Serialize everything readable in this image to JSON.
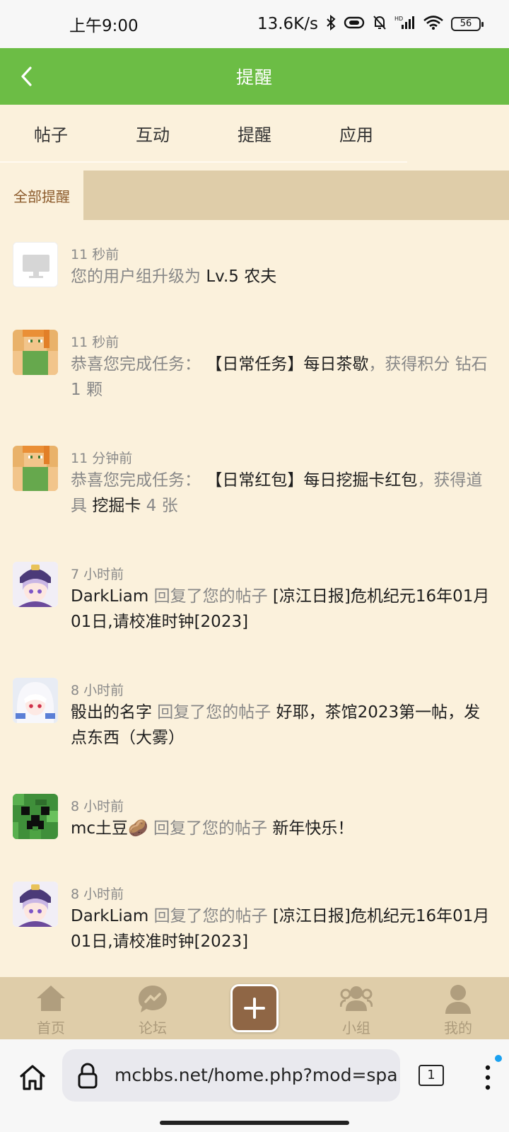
{
  "status_bar": {
    "time": "上午9:00",
    "speed": "13.6K/s",
    "battery": "56"
  },
  "header": {
    "title": "提醒"
  },
  "tabs": [
    {
      "label": "帖子"
    },
    {
      "label": "互动"
    },
    {
      "label": "提醒"
    },
    {
      "label": "应用"
    }
  ],
  "filter": {
    "label": "全部提醒"
  },
  "notifications": [
    {
      "time": "11 秒前",
      "avatar": "monitor-icon",
      "parts": [
        {
          "text": "您的用户组升级为 ",
          "dark": false
        },
        {
          "text": "Lv.5 农夫",
          "dark": true
        }
      ]
    },
    {
      "time": "11 秒前",
      "avatar": "alex-avatar",
      "parts": [
        {
          "text": "恭喜您完成任务： ",
          "dark": false
        },
        {
          "text": "【日常任务】每日茶歇",
          "dark": true
        },
        {
          "text": "，获得积分 ",
          "dark": false
        },
        {
          "text": "钻石 1 颗",
          "dark": false
        }
      ]
    },
    {
      "time": "11 分钟前",
      "avatar": "alex-avatar",
      "parts": [
        {
          "text": "恭喜您完成任务： ",
          "dark": false
        },
        {
          "text": "【日常红包】每日挖掘卡红包",
          "dark": true
        },
        {
          "text": "，获得道具 ",
          "dark": false
        },
        {
          "text": "挖掘卡",
          "dark": true
        },
        {
          "text": " 4 张",
          "dark": false
        }
      ]
    },
    {
      "time": "7 小时前",
      "avatar": "anime-avatar",
      "parts": [
        {
          "text": "DarkLiam",
          "dark": true
        },
        {
          "text": " 回复了您的帖子 ",
          "dark": false
        },
        {
          "text": "[凉江日报]危机纪元16年01月01日,请校准时钟[2023]",
          "dark": true
        }
      ]
    },
    {
      "time": "8 小时前",
      "avatar": "anime-avatar-white",
      "parts": [
        {
          "text": "骰出的名字",
          "dark": true
        },
        {
          "text": " 回复了您的帖子 ",
          "dark": false
        },
        {
          "text": "好耶，茶馆2023第一帖，发点东西（大雾）",
          "dark": true
        }
      ]
    },
    {
      "time": "8 小时前",
      "avatar": "creeper-avatar",
      "parts": [
        {
          "text": "mc土豆🥔",
          "dark": true
        },
        {
          "text": " 回复了您的帖子 ",
          "dark": false
        },
        {
          "text": "新年快乐！",
          "dark": true
        }
      ]
    },
    {
      "time": "8 小时前",
      "avatar": "anime-avatar",
      "parts": [
        {
          "text": "DarkLiam",
          "dark": true
        },
        {
          "text": " 回复了您的帖子 ",
          "dark": false
        },
        {
          "text": "[凉江日报]危机纪元16年01月01日,请校准时钟[2023]",
          "dark": true
        }
      ]
    }
  ],
  "bottom_nav": [
    {
      "label": "首页",
      "icon": "home-icon"
    },
    {
      "label": "论坛",
      "icon": "forum-icon"
    },
    {
      "label": "",
      "icon": "plus-icon"
    },
    {
      "label": "小组",
      "icon": "group-icon"
    },
    {
      "label": "我的",
      "icon": "user-icon"
    }
  ],
  "browser": {
    "url": "mcbbs.net/home.php?mod=spa",
    "tab_count": "1"
  }
}
